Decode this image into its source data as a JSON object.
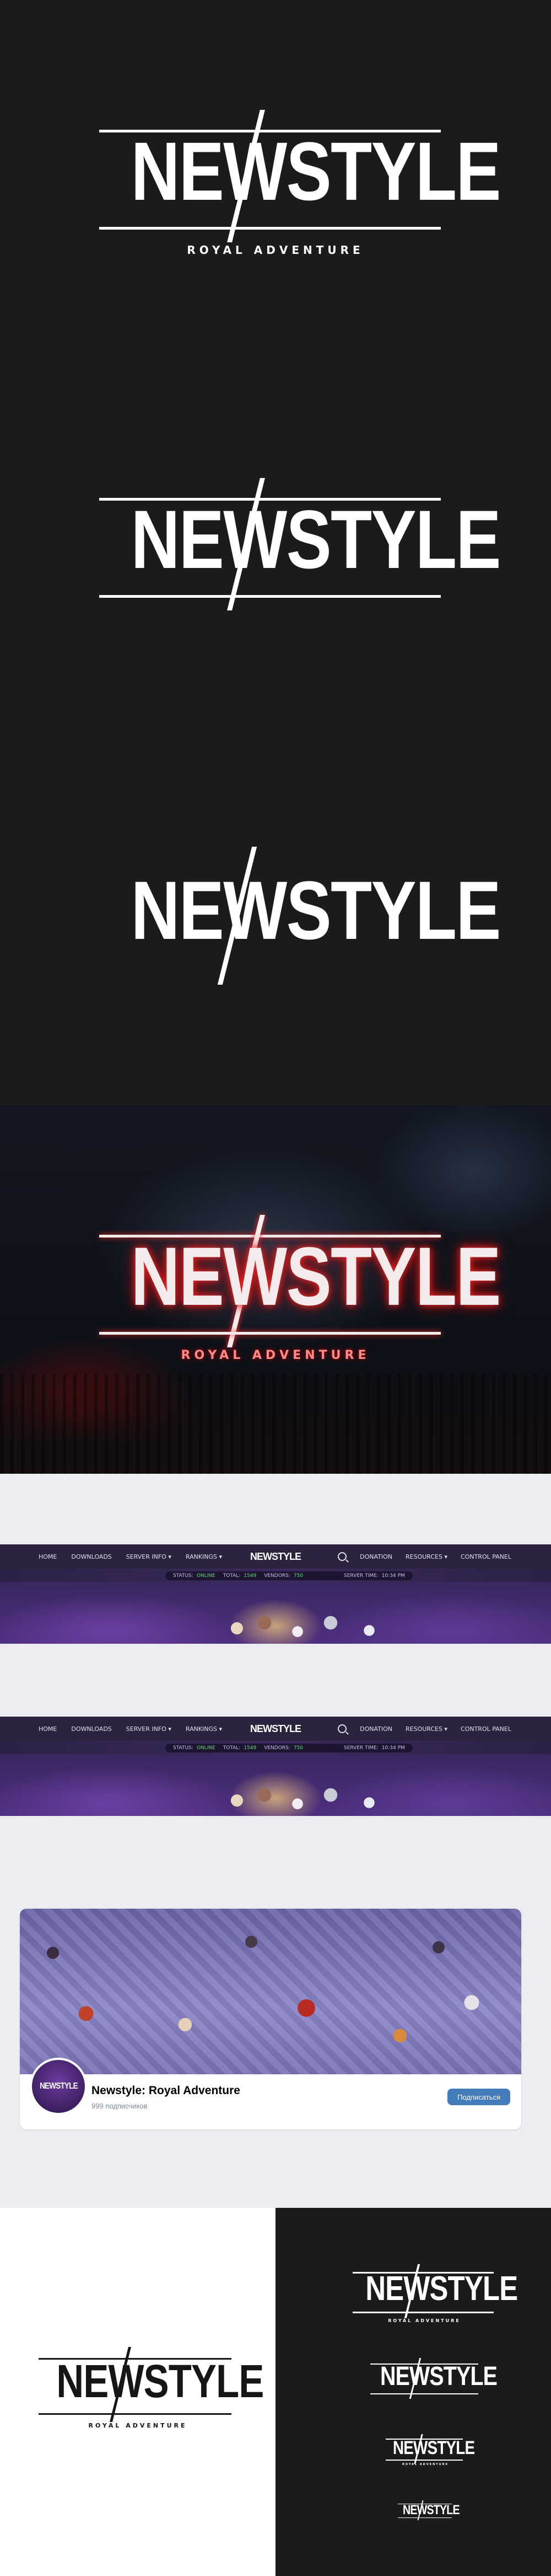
{
  "brand": {
    "wordmark": "NEWSTYLE",
    "tagline": "ROYAL ADVENTURE"
  },
  "colors": {
    "dark_bg": "#1b1b1b",
    "light_bg": "#ebedf0",
    "nav_bg": "#2e233f",
    "online_green": "#55e06a",
    "glow_red": "#ff2a2a",
    "vk_blue": "#447bba"
  },
  "site": {
    "nav_left": [
      "HOME",
      "DOWNLOADS",
      "SERVER INFO ▾",
      "RANKINGS ▾"
    ],
    "nav_right": [
      "DONATION",
      "RESOURCES ▾",
      "CONTROL PANEL"
    ],
    "search_icon": "search-icon",
    "status": {
      "label_status": "STATUS:",
      "value_status": "ONLINE",
      "label_total": "TOTAL:",
      "value_total": "1549",
      "label_vendors": "VENDORS:",
      "value_vendors": "750",
      "label_time": "SERVER TIME:",
      "value_time": "10:34 PM"
    }
  },
  "community": {
    "name": "Newstyle: Royal Adventure",
    "subscribers": "999 подписчиков",
    "subscribe_label": "Подписаться"
  }
}
